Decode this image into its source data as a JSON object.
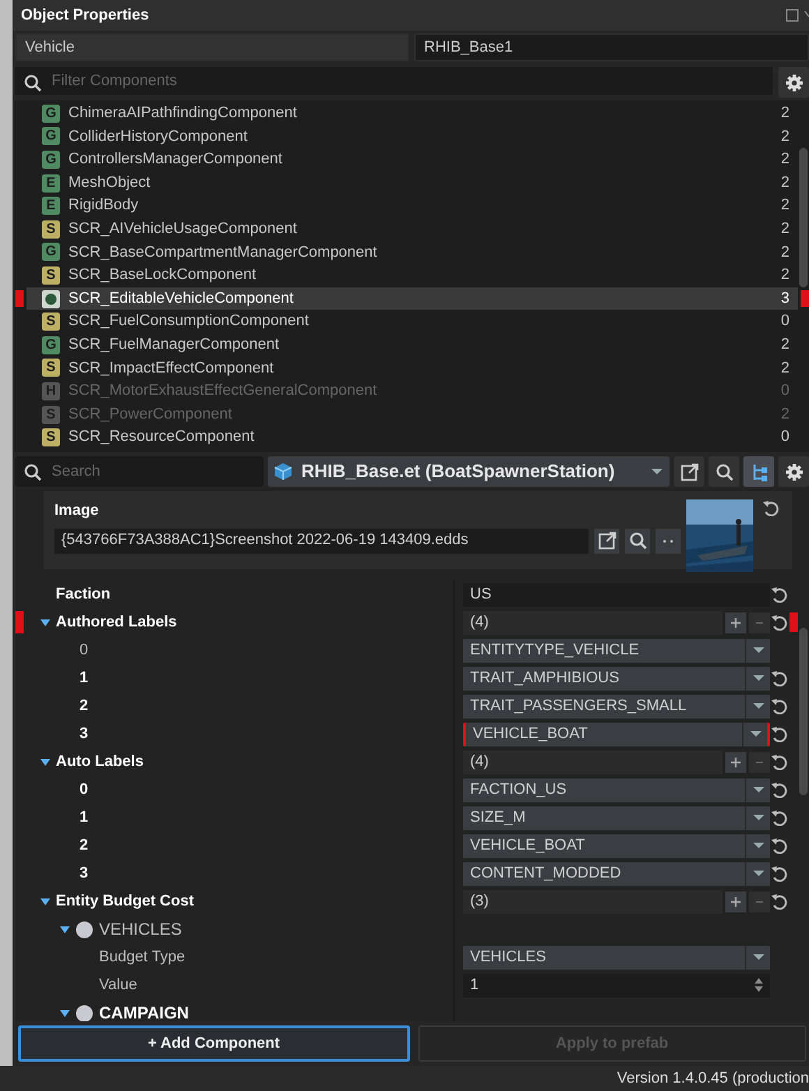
{
  "window": {
    "title": "Object Properties"
  },
  "entity": {
    "type": "Vehicle",
    "name": "RHIB_Base1"
  },
  "filter": {
    "placeholder": "Filter Components"
  },
  "components": [
    {
      "kind": "generic",
      "badge": "G",
      "name": "ChimeraAIPathfindingComponent",
      "count": "2",
      "selected": false,
      "disabled": false,
      "flagged": false
    },
    {
      "kind": "generic",
      "badge": "G",
      "name": "ColliderHistoryComponent",
      "count": "2",
      "selected": false,
      "disabled": false,
      "flagged": false
    },
    {
      "kind": "generic",
      "badge": "G",
      "name": "ControllersManagerComponent",
      "count": "2",
      "selected": false,
      "disabled": false,
      "flagged": false
    },
    {
      "kind": "entity",
      "badge": "E",
      "name": "MeshObject",
      "count": "2",
      "selected": false,
      "disabled": false,
      "flagged": false
    },
    {
      "kind": "entity",
      "badge": "E",
      "name": "RigidBody",
      "count": "2",
      "selected": false,
      "disabled": false,
      "flagged": false
    },
    {
      "kind": "script",
      "badge": "S",
      "name": "SCR_AIVehicleUsageComponent",
      "count": "2",
      "selected": false,
      "disabled": false,
      "flagged": false
    },
    {
      "kind": "generic",
      "badge": "G",
      "name": "SCR_BaseCompartmentManagerComponent",
      "count": "2",
      "selected": false,
      "disabled": false,
      "flagged": false
    },
    {
      "kind": "script",
      "badge": "S",
      "name": "SCR_BaseLockComponent",
      "count": "2",
      "selected": false,
      "disabled": false,
      "flagged": false
    },
    {
      "kind": "custom",
      "name": "SCR_EditableVehicleComponent",
      "count": "3",
      "selected": true,
      "disabled": false,
      "flagged": true
    },
    {
      "kind": "script",
      "badge": "S",
      "name": "SCR_FuelConsumptionComponent",
      "count": "0",
      "selected": false,
      "disabled": false,
      "flagged": false
    },
    {
      "kind": "generic",
      "badge": "G",
      "name": "SCR_FuelManagerComponent",
      "count": "2",
      "selected": false,
      "disabled": false,
      "flagged": false
    },
    {
      "kind": "script",
      "badge": "S",
      "name": "SCR_ImpactEffectComponent",
      "count": "2",
      "selected": false,
      "disabled": false,
      "flagged": false
    },
    {
      "kind": "hidden",
      "badge": "H",
      "name": "SCR_MotorExhaustEffectGeneralComponent",
      "count": "0",
      "selected": false,
      "disabled": true,
      "flagged": false
    },
    {
      "kind": "script",
      "badge": "S",
      "name": "SCR_PowerComponent",
      "count": "2",
      "selected": false,
      "disabled": true,
      "flagged": false
    },
    {
      "kind": "script",
      "badge": "S",
      "name": "SCR_ResourceComponent",
      "count": "0",
      "selected": false,
      "disabled": false,
      "flagged": false
    }
  ],
  "search": {
    "placeholder": "Search"
  },
  "prefab": {
    "value": "RHIB_Base.et (BoatSpawnerStation)"
  },
  "toolbar": [
    {
      "kind": "open",
      "selected": false
    },
    {
      "kind": "search",
      "selected": false
    },
    {
      "kind": "hierarchy",
      "selected": true
    },
    {
      "kind": "settings",
      "selected": false
    }
  ],
  "properties": [
    {
      "kind": "resource",
      "label": "Image",
      "value": "{543766F73A388AC1}Screenshot 2022-06-19 143409.edds",
      "overridden": true,
      "flagged": false
    },
    {
      "kind": "text",
      "label": "Faction",
      "value": "US",
      "overridden": true,
      "flagged": false
    },
    {
      "kind": "array",
      "label": "Authored Labels",
      "value": "(4)",
      "expanded": true,
      "overridden": true,
      "flagged": true,
      "children": [
        {
          "kind": "dropdown",
          "label": "0",
          "value": "ENTITYTYPE_VEHICLE",
          "overridden": false,
          "flagged": false
        },
        {
          "kind": "dropdown",
          "label": "1",
          "value": "TRAIT_AMPHIBIOUS",
          "overridden": true,
          "flagged": false
        },
        {
          "kind": "dropdown",
          "label": "2",
          "value": "TRAIT_PASSENGERS_SMALL",
          "overridden": true,
          "flagged": false
        },
        {
          "kind": "dropdown",
          "label": "3",
          "value": "VEHICLE_BOAT",
          "overridden": true,
          "flagged": true
        }
      ]
    },
    {
      "kind": "array",
      "label": "Auto Labels",
      "value": "(4)",
      "expanded": true,
      "overridden": true,
      "flagged": false,
      "children": [
        {
          "kind": "dropdown",
          "label": "0",
          "value": "FACTION_US",
          "overridden": true,
          "flagged": false
        },
        {
          "kind": "dropdown",
          "label": "1",
          "value": "SIZE_M",
          "overridden": true,
          "flagged": false
        },
        {
          "kind": "dropdown",
          "label": "2",
          "value": "VEHICLE_BOAT",
          "overridden": true,
          "flagged": false
        },
        {
          "kind": "dropdown",
          "label": "3",
          "value": "CONTENT_MODDED",
          "overridden": true,
          "flagged": false
        }
      ]
    },
    {
      "kind": "array",
      "label": "Entity Budget Cost",
      "value": "(3)",
      "expanded": true,
      "overridden": true,
      "flagged": false,
      "children": [
        {
          "kind": "group",
          "label": "VEHICLES",
          "expanded": true,
          "overridden": false,
          "children": [
            {
              "kind": "dropdown",
              "label": "Budget Type",
              "value": "VEHICLES",
              "overridden": false,
              "flagged": false
            },
            {
              "kind": "number",
              "label": "Value",
              "value": "1",
              "overridden": false
            }
          ]
        },
        {
          "kind": "group",
          "label": "CAMPAIGN",
          "expanded": true,
          "overridden": true
        }
      ]
    }
  ],
  "buttons": [
    {
      "label": "+ Add Component",
      "selected": true,
      "disabled": false
    },
    {
      "label": "Apply to prefab",
      "selected": false,
      "disabled": true
    }
  ],
  "status_bar": "Version 1.4.0.45 (production"
}
